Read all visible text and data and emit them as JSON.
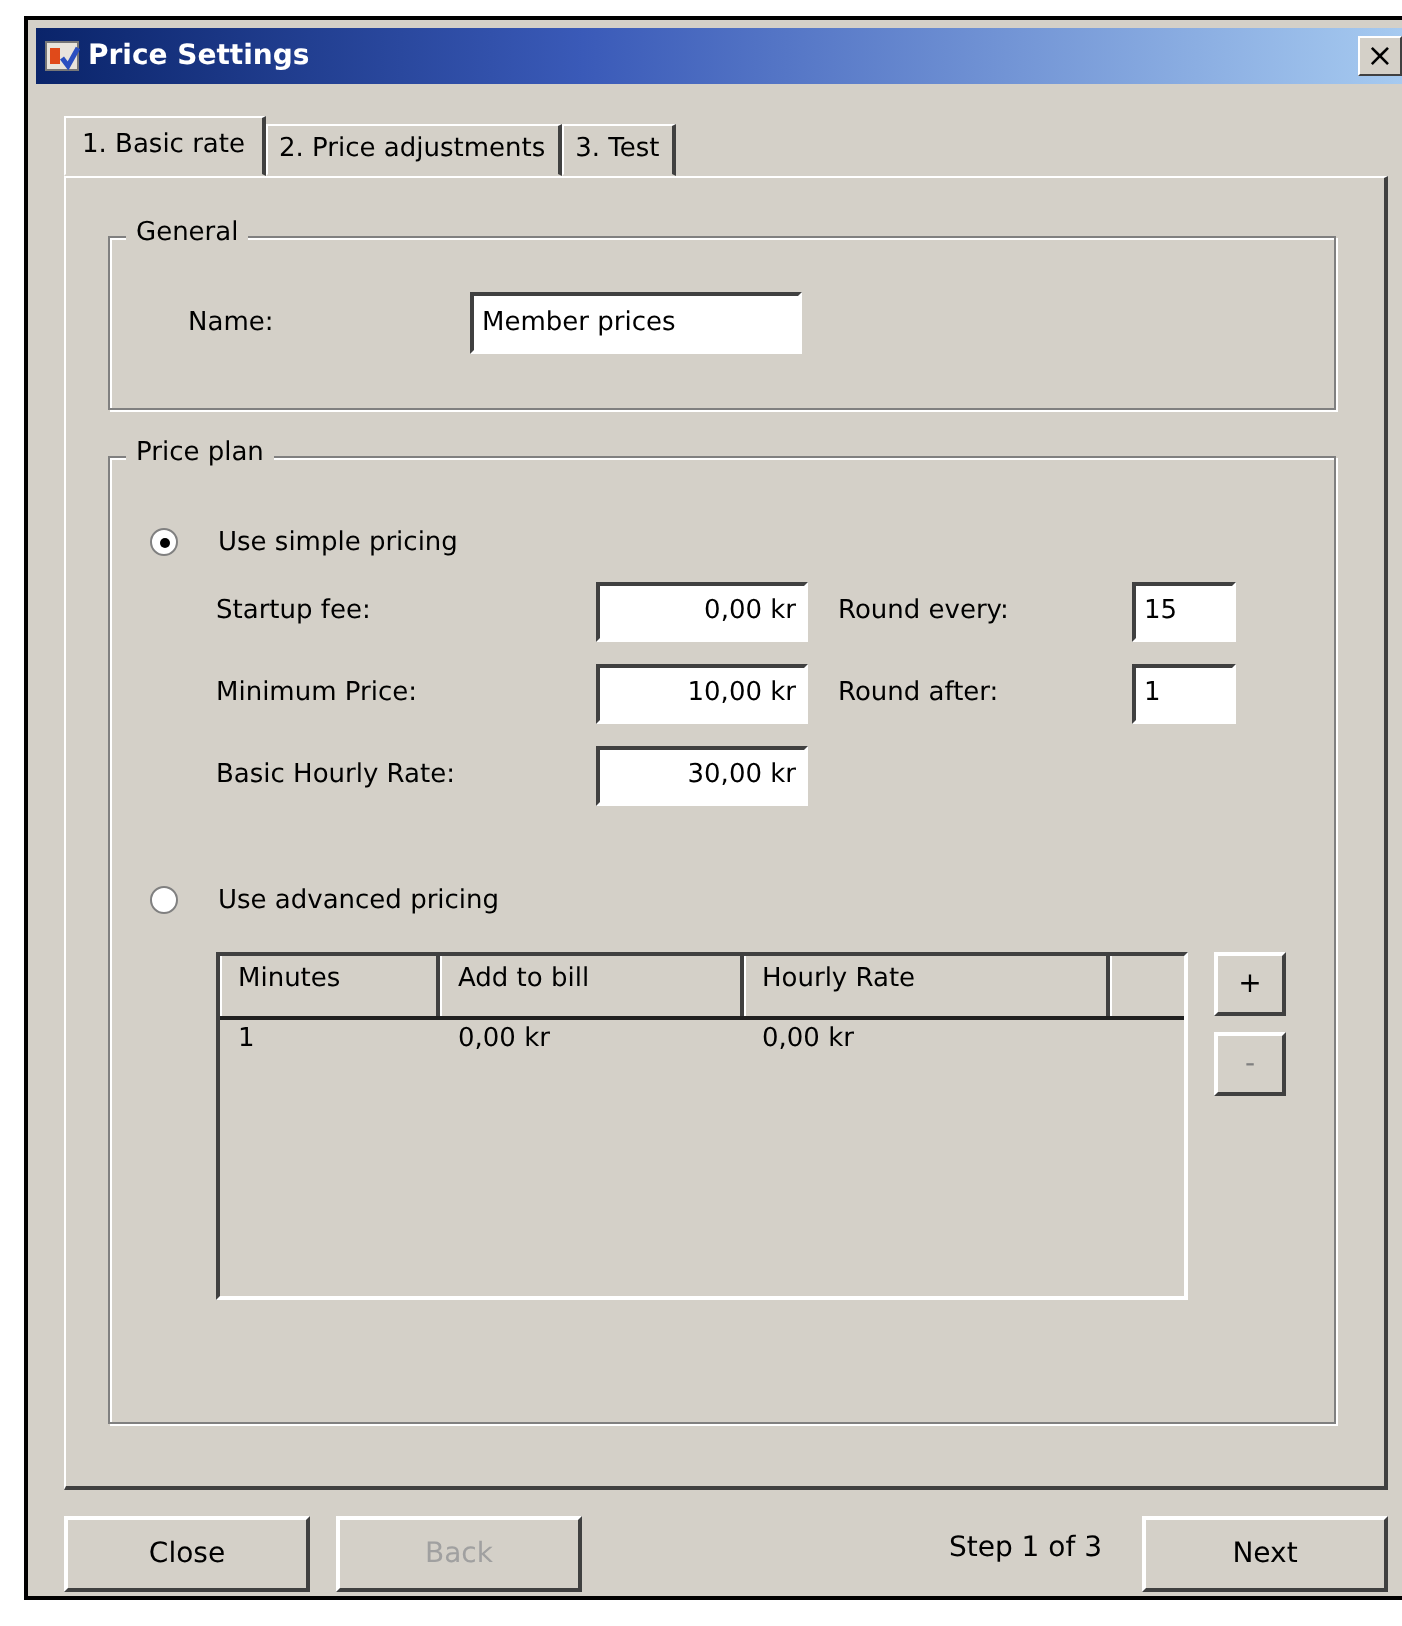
{
  "window": {
    "title": "Price Settings",
    "close": "×"
  },
  "tabs": [
    {
      "label": "1. Basic rate",
      "selected": true
    },
    {
      "label": "2. Price adjustments",
      "selected": false
    },
    {
      "label": "3. Test",
      "selected": false
    }
  ],
  "general": {
    "legend": "General",
    "name_label": "Name:",
    "name_value": "Member prices"
  },
  "price_plan": {
    "legend": "Price plan",
    "options": [
      {
        "label": "Use simple pricing",
        "selected": true
      },
      {
        "label": "Use advanced pricing",
        "selected": false
      }
    ],
    "simple_fields": [
      {
        "label": "Startup fee:",
        "value": "0,00 kr"
      },
      {
        "label": "Minimum Price:",
        "value": "10,00 kr"
      },
      {
        "label": "Basic Hourly Rate:",
        "value": "30,00 kr"
      }
    ],
    "round_fields": [
      {
        "label": "Round every:",
        "value": "15"
      },
      {
        "label": "Round after:",
        "value": "1"
      }
    ],
    "table": {
      "columns": [
        "Minutes",
        "Add to bill",
        "Hourly Rate"
      ],
      "rows": [
        [
          "1",
          "0,00 kr",
          "0,00 kr"
        ]
      ]
    },
    "add_button": "+",
    "remove_button": "-"
  },
  "footer": {
    "buttons": [
      {
        "label": "Close",
        "disabled": false
      },
      {
        "label": "Back",
        "disabled": true
      }
    ],
    "step": "Step 1 of 3",
    "next": "Next"
  }
}
